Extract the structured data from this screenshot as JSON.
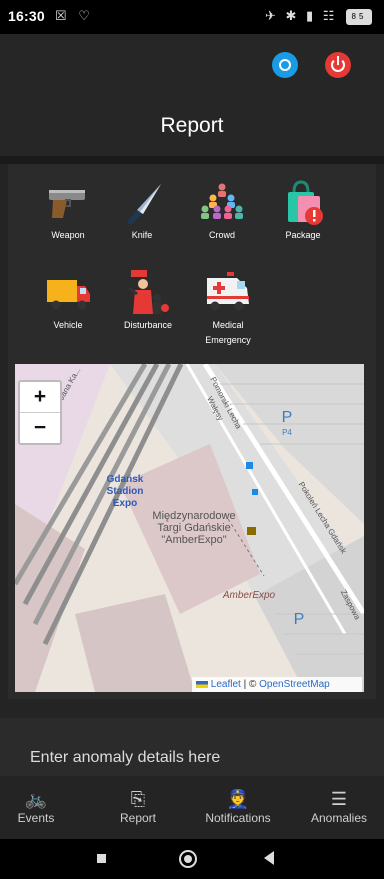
{
  "status_bar": {
    "time": "16:30",
    "left_icons": "☒ ♡",
    "right_icons": "✈ ✱ ▮ ☷",
    "battery": "85"
  },
  "header": {
    "title": "Report",
    "settings_icon": "settings-icon",
    "power_icon": "power-icon"
  },
  "categories": [
    {
      "label": "Weapon",
      "icon": "pistol-icon"
    },
    {
      "label": "Knife",
      "icon": "knife-icon"
    },
    {
      "label": "Crowd",
      "icon": "crowd-icon"
    },
    {
      "label": "Package",
      "icon": "package-icon"
    },
    {
      "label": "Vehicle",
      "icon": "truck-icon"
    },
    {
      "label": "Disturbance",
      "icon": "disturbance-icon"
    },
    {
      "label": "Medical Emergency",
      "icon": "ambulance-icon"
    }
  ],
  "map": {
    "zoom_in": "+",
    "zoom_out": "−",
    "labels": {
      "stadion": "Gdańsk Stadion Expo",
      "expo": "Międzynarodowe Targi Gdańskie \"AmberExpo\"",
      "amberexpo": "AmberExpo",
      "street1": "Jana Ka...",
      "street2": "Pomorski Lecha Wałęsy",
      "street3": "Pokoleń Lecha Gdańsk",
      "street4": "Zaspowa",
      "parking1": "P",
      "parking1_sub": "P4",
      "parking2": "P"
    },
    "attribution_leaflet": "Leaflet",
    "attribution_sep": " | © ",
    "attribution_osm": "OpenStreetMap"
  },
  "input": {
    "placeholder": "Enter anomaly details here",
    "value": ""
  },
  "bottom_nav": [
    {
      "label": "Events",
      "icon": "bicycle-icon",
      "glyph": "🚲"
    },
    {
      "label": "Report",
      "icon": "report-icon",
      "glyph": "⎘"
    },
    {
      "label": "Notifications",
      "icon": "police-icon",
      "glyph": "👮"
    },
    {
      "label": "Anomalies",
      "icon": "list-icon",
      "glyph": "☰"
    }
  ],
  "colors": {
    "settings": "#1a9be6",
    "power": "#e53935",
    "background": "#242424"
  }
}
